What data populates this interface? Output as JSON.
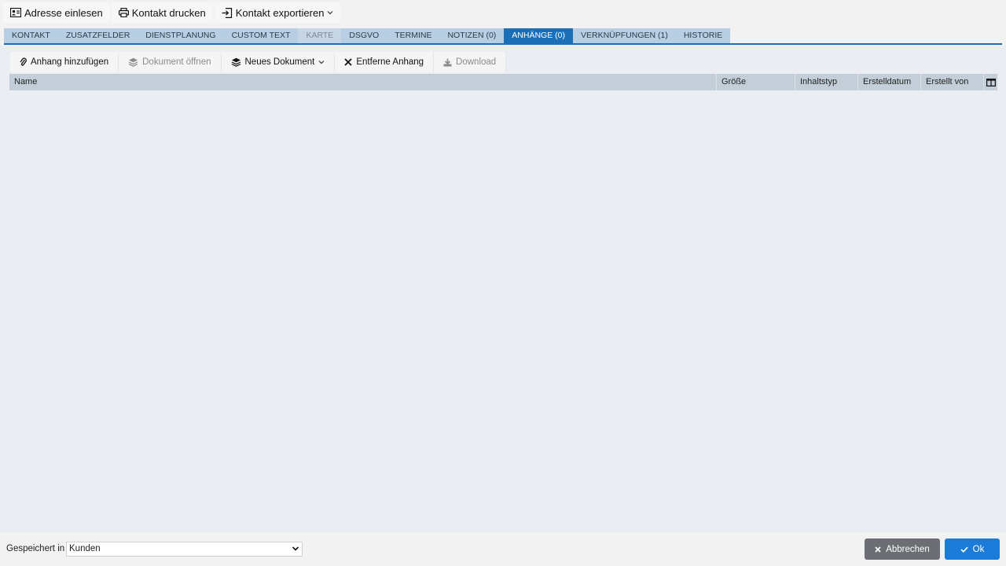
{
  "toolbar": {
    "read_address": "Adresse einlesen",
    "print_contact": "Kontakt drucken",
    "export_contact": "Kontakt exportieren"
  },
  "tabs": [
    {
      "label": "KONTAKT",
      "state": "normal"
    },
    {
      "label": "ZUSATZFELDER",
      "state": "normal"
    },
    {
      "label": "DIENSTPLANUNG",
      "state": "normal"
    },
    {
      "label": "CUSTOM TEXT",
      "state": "normal"
    },
    {
      "label": "KARTE",
      "state": "disabled"
    },
    {
      "label": "DSGVO",
      "state": "normal"
    },
    {
      "label": "TERMINE",
      "state": "normal"
    },
    {
      "label": "NOTIZEN (0)",
      "state": "normal"
    },
    {
      "label": "ANHÄNGE (0)",
      "state": "active"
    },
    {
      "label": "VERKNÜPFUNGEN (1)",
      "state": "normal"
    },
    {
      "label": "HISTORIE",
      "state": "normal"
    }
  ],
  "attachments": {
    "add": "Anhang hinzufügen",
    "open": "Dokument öffnen",
    "new_doc": "Neues Dokument",
    "remove": "Entferne Anhang",
    "download": "Download"
  },
  "grid": {
    "columns": [
      "Name",
      "Größe",
      "Inhaltstyp",
      "Erstelldatum",
      "Erstellt von"
    ]
  },
  "footer": {
    "saved_in_label": "Gespeichert in",
    "saved_in_value": "Kunden",
    "cancel": "Abbrechen",
    "ok": "Ok"
  },
  "colors": {
    "accent": "#1b6fb7",
    "tab_bg": "#b8cfe3",
    "ok_button": "#1b7bd8",
    "cancel_button": "#6b6f74"
  }
}
